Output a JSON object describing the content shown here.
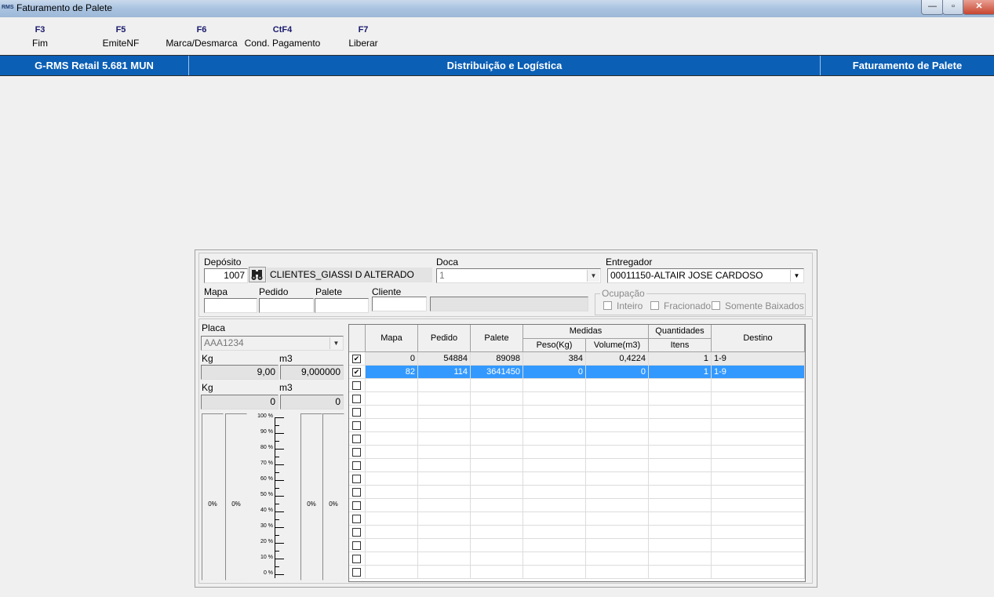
{
  "window": {
    "logo_text": "RMS",
    "title": "Faturamento de Palete",
    "minimize_symbol": "—",
    "maximize_symbol": "▫",
    "close_symbol": "✕"
  },
  "toolbar": {
    "items": [
      {
        "key": "F3",
        "label": "Fim"
      },
      {
        "key": "F5",
        "label": "EmiteNF"
      },
      {
        "key": "F6",
        "label": "Marca/Desmarca"
      },
      {
        "key": "CtF4",
        "label": "Cond. Pagamento"
      },
      {
        "key": "F7",
        "label": "Liberar"
      }
    ]
  },
  "header": {
    "app": "G-RMS Retail 5.681 MUN",
    "module": "Distribuição e Logística",
    "screen": "Faturamento de Palete"
  },
  "form": {
    "deposito_label": "Depósito",
    "deposito_code": "1007",
    "deposito_name": "CLIENTES_GIASSI D ALTERADO",
    "doca_label": "Doca",
    "doca_value": "1",
    "entregador_label": "Entregador",
    "entregador_value": "00011150-ALTAIR JOSE CARDOSO",
    "mapa_label": "Mapa",
    "mapa_value": "",
    "pedido_label": "Pedido",
    "pedido_value": "",
    "palete_label": "Palete",
    "palete_value": "",
    "cliente_label": "Cliente",
    "cliente_code": "",
    "cliente_name": "",
    "ocupacao_label": "Ocupação",
    "ocupacao_options": [
      "Inteiro",
      "Fracionado",
      "Somente Baixados"
    ],
    "binoculars_icon": "binoculars-icon"
  },
  "vehicle": {
    "placa_label": "Placa",
    "placa_value": "AAA1234",
    "kg_label_1": "Kg",
    "m3_label_1": "m3",
    "kg_value_1": "9,00",
    "m3_value_1": "9,000000",
    "kg_label_2": "Kg",
    "m3_label_2": "m3",
    "kg_value_2": "0",
    "m3_value_2": "0",
    "gauge_values": [
      "0%",
      "0%",
      "0%",
      "0%"
    ],
    "scale_ticks": [
      "100 %",
      "90 %",
      "80 %",
      "70 %",
      "60 %",
      "50 %",
      "40 %",
      "30 %",
      "20 %",
      "10 %",
      "0 %"
    ]
  },
  "grid": {
    "headers": {
      "mapa": "Mapa",
      "pedido": "Pedido",
      "palete": "Palete",
      "medidas": "Medidas",
      "peso": "Peso(Kg)",
      "volume": "Volume(m3)",
      "quantidades": "Quantidades",
      "itens": "Itens",
      "destino": "Destino"
    },
    "rows": [
      {
        "checked": true,
        "mapa": "0",
        "pedido": "54884",
        "palete": "89098",
        "peso": "384",
        "volume": "0,4224",
        "itens": "1",
        "destino": "1-9"
      },
      {
        "checked": true,
        "mapa": "82",
        "pedido": "114",
        "palete": "3641450",
        "peso": "0",
        "volume": "0",
        "itens": "1",
        "destino": "1-9"
      }
    ],
    "empty_rows": 15,
    "check_mark": "✔",
    "selection_color": "#3399ff"
  },
  "colors": {
    "header_blue": "#0b5fb5"
  }
}
